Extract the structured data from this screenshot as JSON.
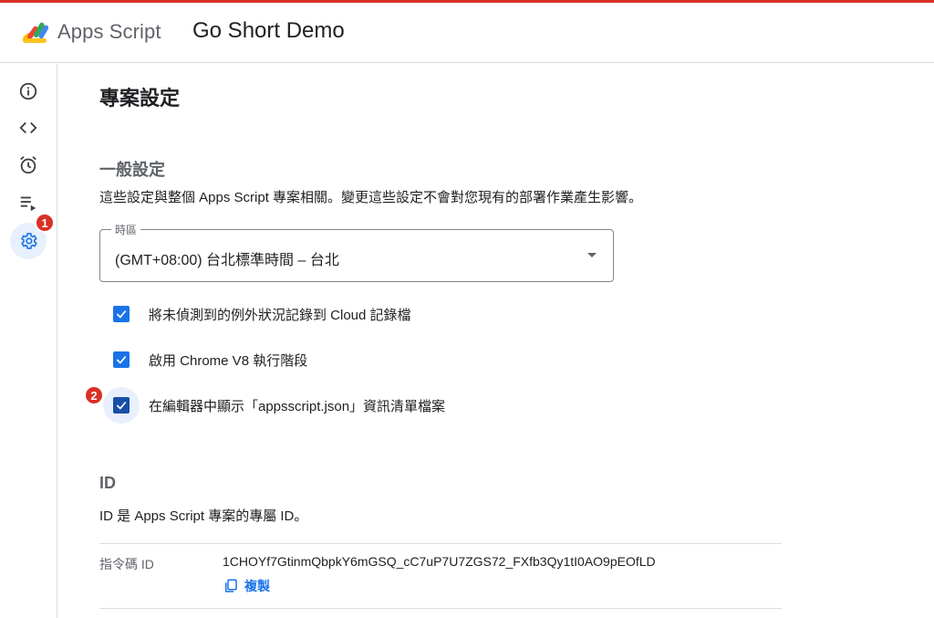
{
  "header": {
    "brand": "Apps Script",
    "project_title": "Go Short Demo"
  },
  "sidebar": {
    "items": [
      {
        "icon": "info-icon"
      },
      {
        "icon": "code-icon"
      },
      {
        "icon": "alarm-icon"
      },
      {
        "icon": "executions-icon"
      },
      {
        "icon": "gear-icon",
        "active": true,
        "badge": "1"
      }
    ]
  },
  "main": {
    "page_title": "專案設定",
    "general": {
      "title": "一般設定",
      "description": "這些設定與整個 Apps Script 專案相關。變更這些設定不會對您現有的部署作業產生影響。",
      "timezone": {
        "label": "時區",
        "value": "(GMT+08:00) 台北標準時間 – 台北"
      },
      "checkboxes": [
        {
          "label": "將未偵測到的例外狀況記錄到 Cloud 記錄檔",
          "checked": true
        },
        {
          "label": "啟用 Chrome V8 執行階段",
          "checked": true
        },
        {
          "label": "在編輯器中顯示「appsscript.json」資訊清單檔案",
          "checked": true,
          "badge": "2"
        }
      ]
    },
    "id_section": {
      "title": "ID",
      "description": "ID 是 Apps Script 專案的專屬 ID。",
      "script_id_label": "指令碼 ID",
      "script_id_value": "1CHOYf7GtinmQbpkY6mGSQ_cC7uP7U7ZGS72_FXfb3Qy1tI0AO9pEOfLD",
      "copy_label": "複製"
    }
  },
  "colors": {
    "accent": "#1a73e8",
    "badge": "#d93025",
    "active_bg": "#e8f0fe"
  }
}
